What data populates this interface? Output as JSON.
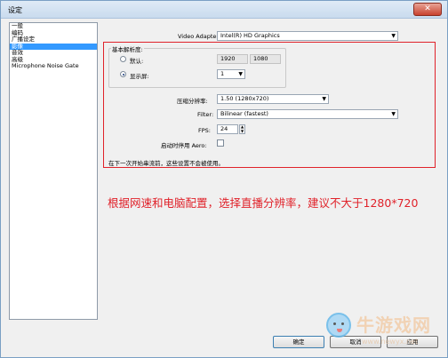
{
  "window": {
    "title": "设定",
    "close_label": "✕"
  },
  "sidebar": {
    "items": [
      {
        "label": "一般",
        "selected": false
      },
      {
        "label": "编码",
        "selected": false
      },
      {
        "label": "广播设定",
        "selected": false
      },
      {
        "label": "影像",
        "selected": true
      },
      {
        "label": "音效",
        "selected": false
      },
      {
        "label": "高级",
        "selected": false
      },
      {
        "label": "Microphone Noise Gate",
        "selected": false
      }
    ]
  },
  "video": {
    "adapter_label": "Video Adapter:",
    "adapter_value": "Intel(R) HD Graphics",
    "base_resolution_label": "基本解析度:",
    "custom_label": "默认:",
    "custom_width": "1920",
    "custom_height": "1080",
    "monitor_label": "显示屏:",
    "monitor_value": "1",
    "downscale_label": "压缩分辨率:",
    "downscale_value": "1.50  (1280x720)",
    "filter_label": "Filter:",
    "filter_value": "Bilinear (fastest)",
    "fps_label": "FPS:",
    "fps_value": "24",
    "aero_label": "启动时停用 Aero:",
    "note": "在下一次开始串流前，这些设置不会被使用。"
  },
  "annotation": "根据网速和电脑配置，选择直播分辨率，建议不大于1280*720",
  "buttons": {
    "ok": "确定",
    "cancel": "取消",
    "apply": "应用"
  },
  "watermark": {
    "text": "牛游戏网",
    "url": "www.newyx.net"
  },
  "icons": {
    "dropdown": "▼",
    "spin_up": "▲",
    "spin_down": "▼"
  }
}
